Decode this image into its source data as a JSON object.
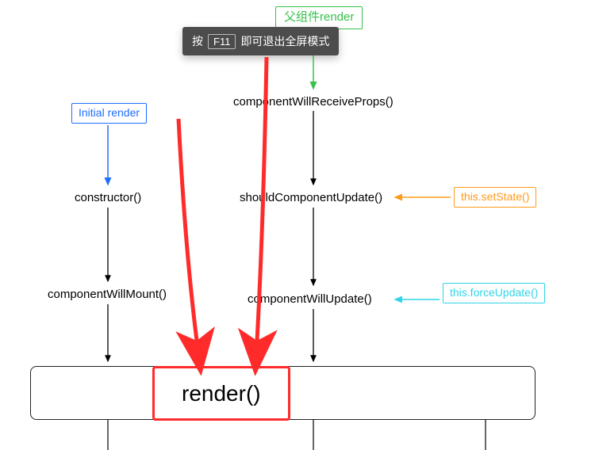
{
  "tooltip": {
    "prefix": "按",
    "key": "F11",
    "suffix": "即可退出全屏模式"
  },
  "nodes": {
    "parent_render": "父组件render",
    "initial_render": "Initial render",
    "cwrp": "componentWillReceiveProps()",
    "constructor": "constructor()",
    "scu": "shouldComponentUpdate()",
    "setstate": "this.setState()",
    "cwm": "componentWillMount()",
    "cwu": "componentWillUpdate()",
    "forceupdate": "this.forceUpdate()",
    "render": "render()"
  },
  "diagram": {
    "edges": [
      {
        "from": "Initial render",
        "to": "constructor()",
        "color": "blue"
      },
      {
        "from": "父组件render",
        "to": "componentWillReceiveProps()",
        "color": "green"
      },
      {
        "from": "constructor()",
        "to": "componentWillMount()",
        "color": "black"
      },
      {
        "from": "componentWillReceiveProps()",
        "to": "shouldComponentUpdate()",
        "color": "black"
      },
      {
        "from": "shouldComponentUpdate()",
        "to": "componentWillUpdate()",
        "color": "black"
      },
      {
        "from": "this.setState()",
        "to": "shouldComponentUpdate()",
        "color": "orange"
      },
      {
        "from": "this.forceUpdate()",
        "to": "componentWillUpdate()",
        "color": "cyan"
      },
      {
        "from": "componentWillMount()",
        "to": "render()",
        "color": "black"
      },
      {
        "from": "componentWillUpdate()",
        "to": "render()",
        "color": "black"
      }
    ],
    "annotations": [
      {
        "type": "hand-arrow",
        "from": "父组件render area",
        "to": "render()",
        "color": "red"
      },
      {
        "type": "hand-arrow",
        "from": "Initial render area",
        "to": "render()",
        "color": "red"
      }
    ]
  }
}
